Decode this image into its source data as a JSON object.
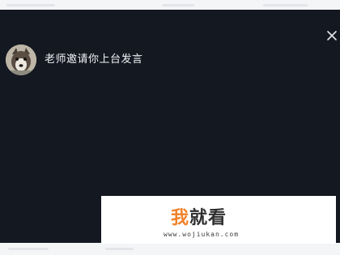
{
  "dialog": {
    "message": "老师邀请你上台发言",
    "close_icon": "close-icon",
    "avatar_icon": "dog-avatar"
  },
  "watermark": {
    "logo_part1": "我",
    "logo_part2": "就看",
    "url": "www.wojiukan.com"
  },
  "colors": {
    "panel_background": "#141821",
    "text": "#f2f3f5",
    "button_border": "#ef6b3a",
    "logo_accent": "#f1822a"
  }
}
